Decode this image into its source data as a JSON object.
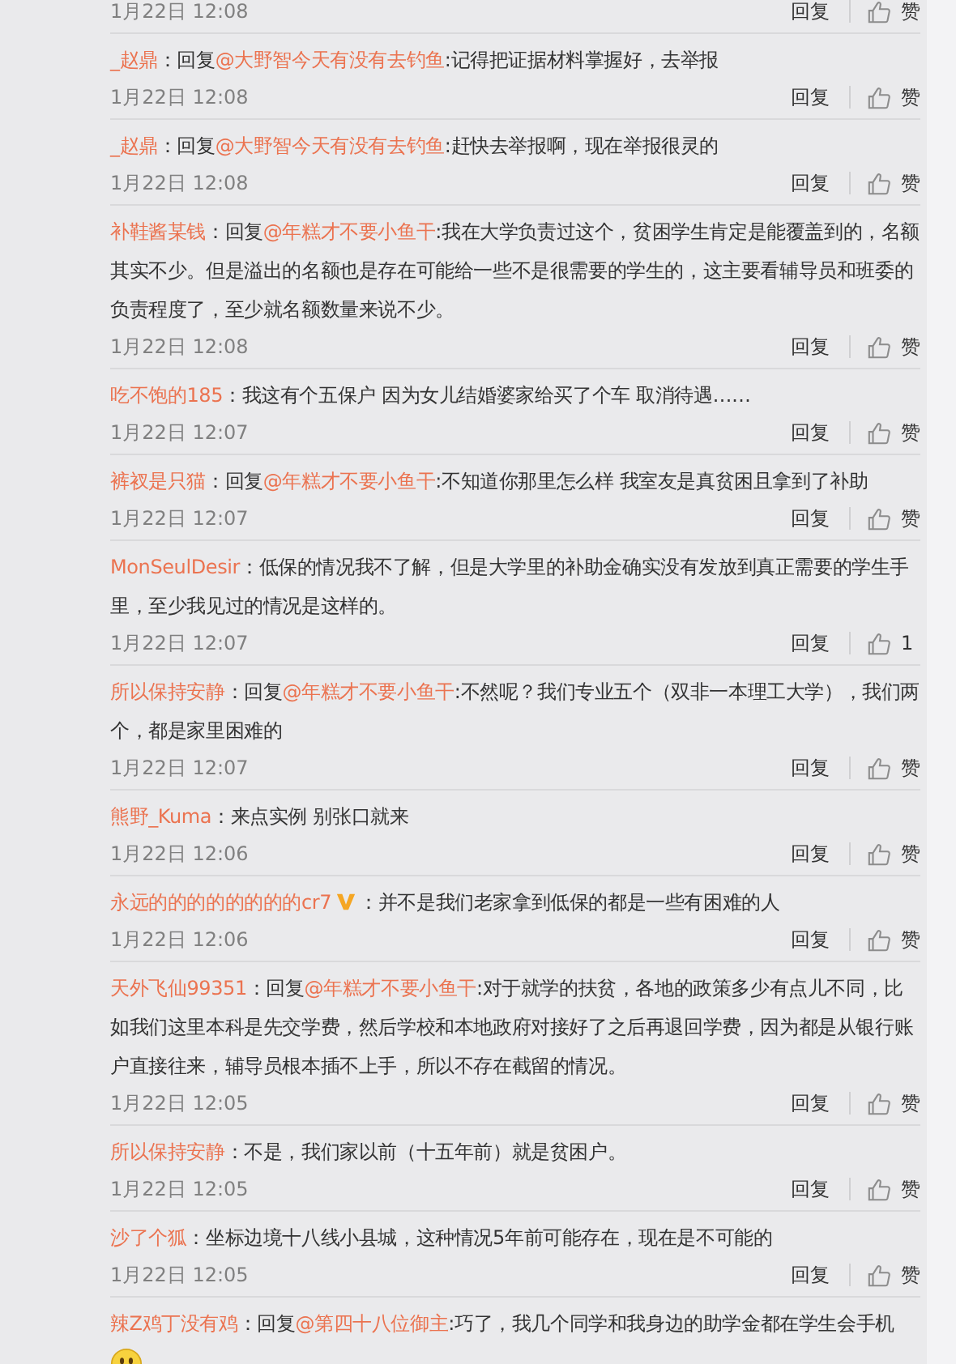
{
  "comments": [
    {
      "kind": "meta",
      "time": "1月22日 12:08",
      "reply": "回复",
      "like": "赞"
    },
    {
      "kind": "comment",
      "author": "_赵鼎",
      "sep": "：",
      "reply_prefix": "回复",
      "mention": "@大野智今天有没有去钓鱼",
      "text": ":记得把证据材料掌握好，去举报",
      "time": "1月22日 12:08",
      "reply": "回复",
      "like": "赞"
    },
    {
      "kind": "comment",
      "author": "_赵鼎",
      "sep": "：",
      "reply_prefix": "回复",
      "mention": "@大野智今天有没有去钓鱼",
      "text": ":赶快去举报啊，现在举报很灵的",
      "time": "1月22日 12:08",
      "reply": "回复",
      "like": "赞"
    },
    {
      "kind": "comment",
      "author": "补鞋酱某钱",
      "sep": "：",
      "reply_prefix": "回复",
      "mention": "@年糕才不要小鱼干",
      "text": ":我在大学负责过这个，贫困学生肯定是能覆盖到的，名额其实不少。但是溢出的名额也是存在可能给一些不是很需要的学生的，这主要看辅导员和班委的负责程度了，至少就名额数量来说不少。",
      "time": "1月22日 12:08",
      "reply": "回复",
      "like": "赞"
    },
    {
      "kind": "comment",
      "author": "吃不饱的185",
      "sep": "：",
      "text": "我这有个五保户  因为女儿结婚婆家给买了个车  取消待遇……",
      "time": "1月22日 12:07",
      "reply": "回复",
      "like": "赞"
    },
    {
      "kind": "comment",
      "author": "裤衩是只猫",
      "sep": "：",
      "reply_prefix": "回复",
      "mention": "@年糕才不要小鱼干",
      "text": ":不知道你那里怎么样 我室友是真贫困且拿到了补助",
      "time": "1月22日 12:07",
      "reply": "回复",
      "like": "赞"
    },
    {
      "kind": "comment",
      "author": "MonSeulDesir",
      "sep": "：",
      "text": "低保的情况我不了解，但是大学里的补助金确实没有发放到真正需要的学生手里，至少我见过的情况是这样的。",
      "time": "1月22日 12:07",
      "reply": "回复",
      "like": "1"
    },
    {
      "kind": "comment",
      "author": "所以保持安静",
      "sep": "：",
      "reply_prefix": "回复",
      "mention": "@年糕才不要小鱼干",
      "text": ":不然呢？我们专业五个（双非一本理工大学），我们两个，都是家里困难的",
      "time": "1月22日 12:07",
      "reply": "回复",
      "like": "赞"
    },
    {
      "kind": "comment",
      "author": "熊野_Kuma",
      "sep": "：",
      "text": "来点实例 别张口就来",
      "time": "1月22日 12:06",
      "reply": "回复",
      "like": "赞"
    },
    {
      "kind": "comment",
      "author": "永远的的的的的的的的cr7",
      "verified": true,
      "sep": "：",
      "text": "并不是我们老家拿到低保的都是一些有困难的人",
      "time": "1月22日 12:06",
      "reply": "回复",
      "like": "赞"
    },
    {
      "kind": "comment",
      "author": "天外飞仙99351",
      "sep": "：",
      "reply_prefix": "回复",
      "mention": "@年糕才不要小鱼干",
      "text": ":对于就学的扶贫，各地的政策多少有点儿不同，比如我们这里本科是先交学费，然后学校和本地政府对接好了之后再退回学费，因为都是从银行账户直接往来，辅导员根本插不上手，所以不存在截留的情况。",
      "time": "1月22日 12:05",
      "reply": "回复",
      "like": "赞"
    },
    {
      "kind": "comment",
      "author": "所以保持安静",
      "sep": "：",
      "text": "不是，我们家以前（十五年前）就是贫困户。",
      "time": "1月22日 12:05",
      "reply": "回复",
      "like": "赞"
    },
    {
      "kind": "comment",
      "author": "沙了个狐",
      "sep": "：",
      "text": "坐标边境十八线小县城，这种情况5年前可能存在，现在是不可能的",
      "time": "1月22日 12:05",
      "reply": "回复",
      "like": "赞"
    },
    {
      "kind": "comment",
      "author": "辣Z鸡丁没有鸡",
      "sep": "：",
      "reply_prefix": "回复",
      "mention": "@第四十八位御主",
      "text": ":巧了，我几个同学和我身边的助学金都在学生会手机",
      "emoji": true
    }
  ]
}
